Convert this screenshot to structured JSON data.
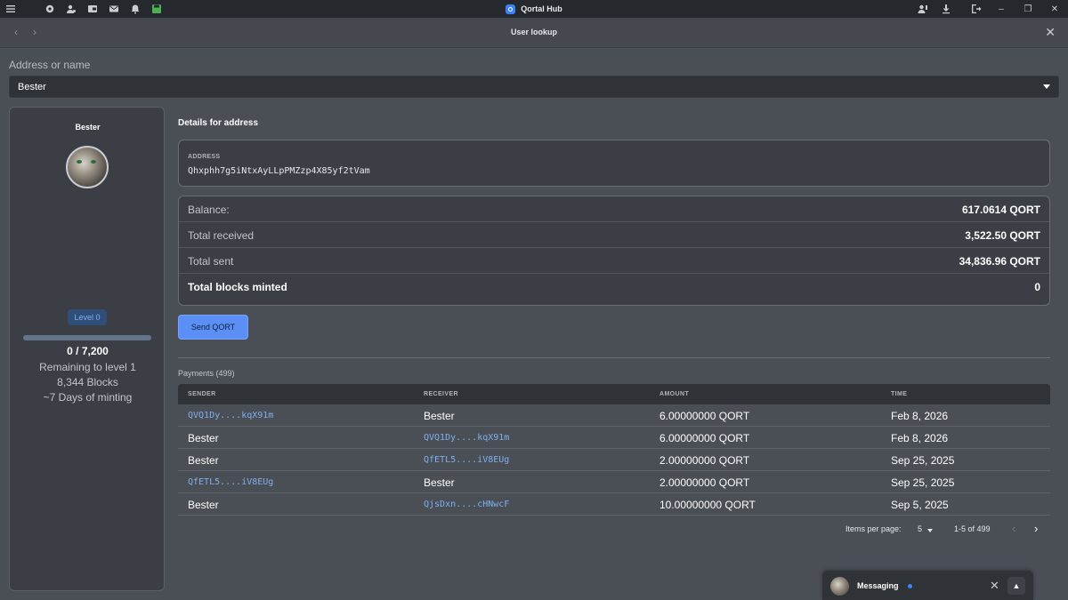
{
  "app": {
    "title": "Qortal Hub"
  },
  "titlebar": {
    "left_icons": [
      "menu-icon",
      "gear-icon",
      "users-icon",
      "wallet-icon",
      "mail-icon",
      "bell-icon",
      "save-icon"
    ],
    "right_icons": [
      "user-settings-icon",
      "download-icon",
      "logout-icon"
    ]
  },
  "modal": {
    "title": "User lookup"
  },
  "lookup": {
    "label": "Address or name",
    "value": "Bester"
  },
  "profile": {
    "name": "Bester",
    "level": "Level 0",
    "progress_fraction": 0,
    "count": "0 / 7,200",
    "remaining": "Remaining to level 1",
    "blocks": "8,344 Blocks",
    "days": "~7 Days of minting"
  },
  "details": {
    "title": "Details for address",
    "address_label": "ADDRESS",
    "address": "Qhxphh7g5iNtxAyLLpPMZzp4X85yf2tVam",
    "stats": [
      {
        "label": "Balance:",
        "value": "617.0614 QORT"
      },
      {
        "label": "Total received",
        "value": "3,522.50 QORT"
      },
      {
        "label": "Total sent",
        "value": "34,836.96 QORT"
      },
      {
        "label": "Total blocks minted",
        "value": "0"
      }
    ],
    "send_button": "Send QORT"
  },
  "payments": {
    "title": "Payments (499)",
    "columns": [
      "SENDER",
      "RECEIVER",
      "AMOUNT",
      "TIME"
    ],
    "rows": [
      {
        "sender": "QVQ1Dy....kqX91m",
        "receiver": "Bester",
        "amount": "6.00000000 QORT",
        "time": "Feb 8, 2026"
      },
      {
        "sender": "Bester",
        "receiver": "QVQ1Dy....kqX91m",
        "amount": "6.00000000 QORT",
        "time": "Feb 8, 2026"
      },
      {
        "sender": "Bester",
        "receiver": "QfETL5....iV8EUg",
        "amount": "2.00000000 QORT",
        "time": "Sep 25, 2025"
      },
      {
        "sender": "QfETL5....iV8EUg",
        "receiver": "Bester",
        "amount": "2.00000000 QORT",
        "time": "Sep 25, 2025"
      },
      {
        "sender": "Bester",
        "receiver": "QjsDxn....cHNwcF",
        "amount": "10.00000000 QORT",
        "time": "Sep 5, 2025"
      }
    ],
    "items_per_page_label": "Items per page:",
    "items_per_page": "5",
    "range": "1-5 of 499"
  },
  "messaging": {
    "label": "Messaging"
  }
}
